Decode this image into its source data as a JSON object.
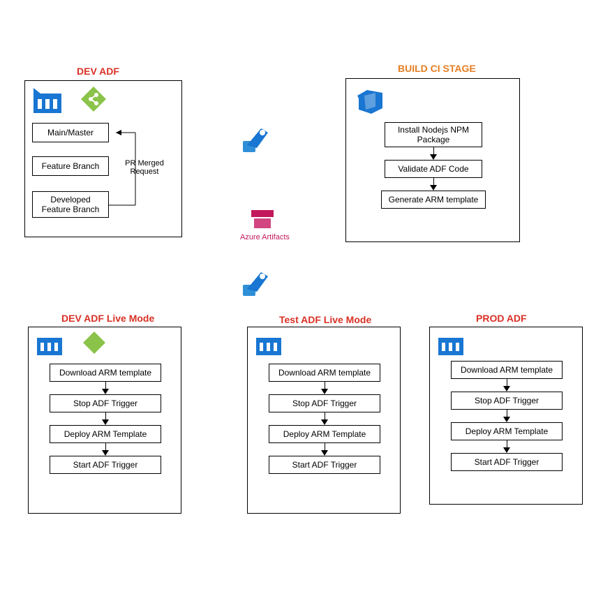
{
  "titles": {
    "dev_adf": "DEV ADF",
    "build_ci": "BUILD CI STAGE",
    "dev_live": "DEV ADF Live Mode",
    "test_live": "Test ADF Live Mode",
    "prod_adf": "PROD ADF"
  },
  "dev_panel": {
    "box1": "Main/Master",
    "box2": "Feature Branch",
    "box3": "Developed Feature Branch",
    "merge_label": "PR Merged Request"
  },
  "build_panel": {
    "step1": "Install Nodejs NPM Package",
    "step2": "Validate ADF Code",
    "step3": "Generate ARM template"
  },
  "middle": {
    "artifacts": "Azure Artifacts"
  },
  "deploy_flow": {
    "step1": "Download ARM template",
    "step2": "Stop ADF Trigger",
    "step3": "Deploy ARM Template",
    "step4": "Start ADF Trigger"
  },
  "icons": {
    "factory": "adf-factory-icon",
    "git": "git-icon",
    "devops": "azure-devops-icon",
    "rocket": "azure-pipeline-icon",
    "artifacts": "azure-artifacts-icon"
  }
}
